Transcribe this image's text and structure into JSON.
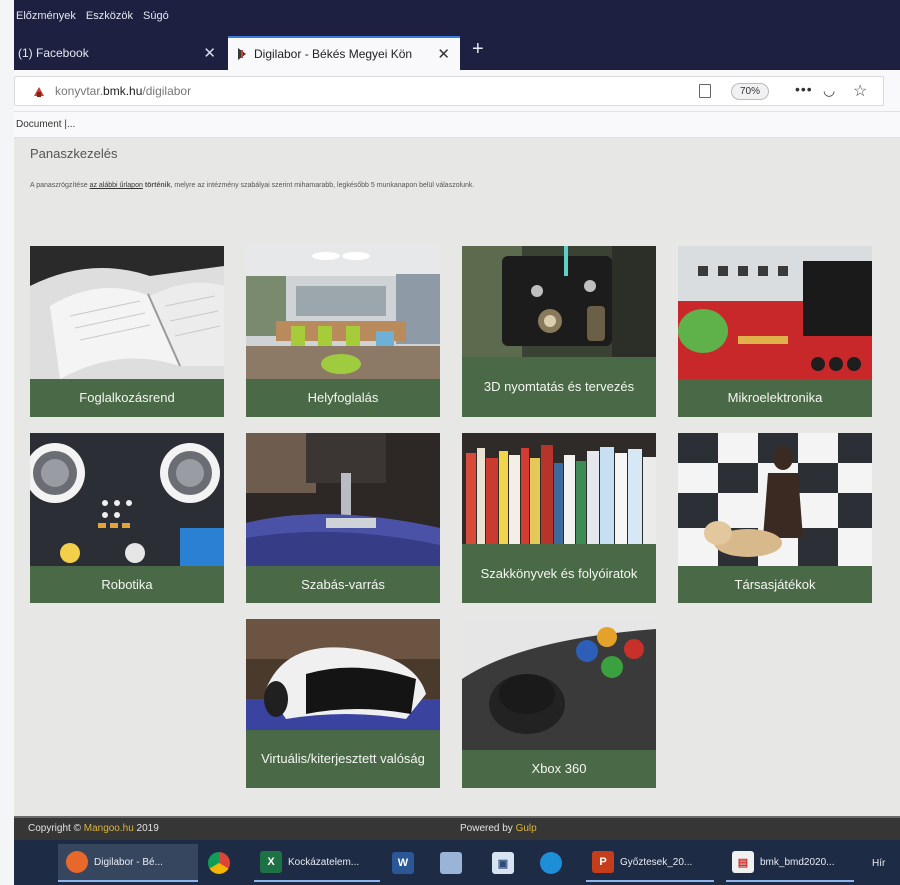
{
  "browser": {
    "menu": [
      "Előzmények",
      "Eszközök",
      "Súgó"
    ],
    "tabs": [
      {
        "title": "(1) Facebook",
        "active": false
      },
      {
        "title": "Digilabor - Békés Megyei Kön",
        "active": true
      }
    ],
    "url": {
      "prefix": "konyvtar.",
      "domain": "bmk.hu",
      "path": "/digilabor"
    },
    "zoom": "70%",
    "bookmark": "Document |..."
  },
  "page": {
    "heading": "Panaszkezelés",
    "intro_prefix": "A panaszrögzítése ",
    "intro_link": "az alábbi űrlapon",
    "intro_bold": " történik",
    "intro_suffix": ", melyre az intézmény szabályai szerint mihamarabb, legkésőbb 5 munkanapon belül válaszolunk.",
    "cards": [
      {
        "label": "Foglalkozásrend",
        "image": "open-notebook"
      },
      {
        "label": "Helyfoglalás",
        "image": "library-room"
      },
      {
        "label": "3D nyomtatás és tervezés",
        "image": "3d-printer"
      },
      {
        "label": "Mikroelektronika",
        "image": "circuit-board"
      },
      {
        "label": "Robotika",
        "image": "robot"
      },
      {
        "label": "Szabás-varrás",
        "image": "sewing-machine"
      },
      {
        "label": "Szakkönyvek és folyóiratok",
        "image": "bookshelf"
      },
      {
        "label": "Társasjátékok",
        "image": "chess-pieces"
      },
      {
        "label": "Virtuális/kiterjesztett valóság",
        "image": "vr-headset"
      },
      {
        "label": "Xbox 360",
        "image": "xbox-controller"
      }
    ],
    "footer": {
      "copyright_prefix": "Copyright © ",
      "copyright_name": "Mangoo.hu",
      "copyright_year": " 2019",
      "powered_prefix": "Powered by ",
      "powered_name": "Gulp"
    }
  },
  "taskbar": [
    {
      "label": "Digilabor - Bé...",
      "icon": "firefox-icon",
      "state": "active"
    },
    {
      "label": "",
      "icon": "chrome-icon",
      "state": "normal"
    },
    {
      "label": "Kockázatelem...",
      "icon": "excel-icon",
      "state": "open"
    },
    {
      "label": "",
      "icon": "word-icon",
      "state": "normal"
    },
    {
      "label": "",
      "icon": "notepad-icon",
      "state": "normal"
    },
    {
      "label": "",
      "icon": "save-icon",
      "state": "normal"
    },
    {
      "label": "",
      "icon": "edge-icon",
      "state": "normal"
    },
    {
      "label": "Győztesek_20...",
      "icon": "powerpoint-icon",
      "state": "open"
    },
    {
      "label": "bmk_bmd2020...",
      "icon": "pdf-icon",
      "state": "open"
    },
    {
      "label": "Hír",
      "icon": "",
      "state": "normal"
    }
  ],
  "colors": {
    "card_green": "#4a6a47",
    "menubar": "#1d2040",
    "taskbar": "#1d2b44",
    "accent": "#3b7bdc"
  }
}
